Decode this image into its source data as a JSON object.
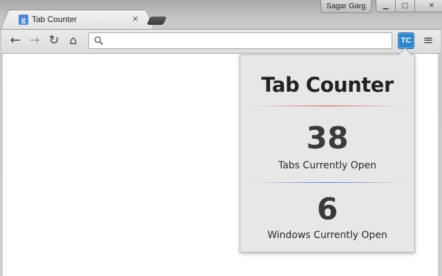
{
  "browser": {
    "tab_title": "Tab Counter",
    "tab_favicon": "g",
    "tab_close_icon": "×",
    "profile_name": "Sagar Garg",
    "window_controls": {
      "minimize": "▁",
      "maximize": "□",
      "close": "✕"
    }
  },
  "toolbar": {
    "back_icon": "←",
    "forward_icon": "→",
    "reload_icon": "↻",
    "home_icon": "⌂",
    "omnibox_value": "",
    "extension_label": "TC",
    "menu_icon": "≡"
  },
  "popup": {
    "title": "Tab Counter",
    "tabs_count": "38",
    "tabs_caption": "Tabs Currently Open",
    "windows_count": "6",
    "windows_caption": "Windows Currently Open",
    "colors": {
      "accent_red": "#cf4a3d",
      "accent_blue": "#4673c8",
      "extension_blue": "#2f86c9"
    }
  }
}
